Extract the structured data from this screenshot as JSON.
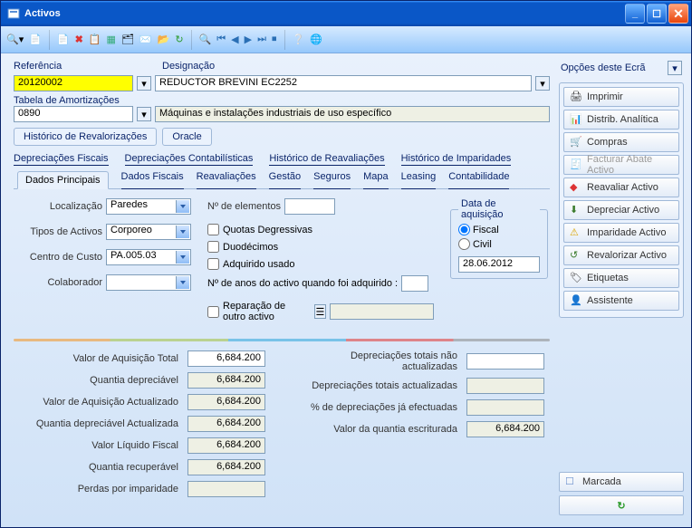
{
  "window": {
    "title": "Activos"
  },
  "header": {
    "ref_label": "Referência",
    "ref_value": "20120002",
    "desig_label": "Designação",
    "desig_value": "REDUCTOR BREVINI EC2252",
    "tab_amort_label": "Tabela de Amortizações",
    "tab_amort_code": "0890",
    "tab_amort_desc": "Máquinas e instalações industriais de uso específico"
  },
  "btnrow": {
    "hist_reval": "Histórico de Revalorizações",
    "oracle": "Oracle"
  },
  "linktabs": [
    "Depreciações Fiscais",
    "Depreciações Contabilísticas",
    "Histórico de Reavaliações",
    "Histórico de Imparidades"
  ],
  "subtabs": [
    "Dados Principais",
    "Dados Fiscais",
    "Reavaliações",
    "Gestão",
    "Seguros",
    "Mapa",
    "Leasing",
    "Contabilidade"
  ],
  "form": {
    "localizacao": {
      "label": "Localização",
      "value": "Paredes"
    },
    "tipos": {
      "label": "Tipos de Activos",
      "value": "Corporeo"
    },
    "centro": {
      "label": "Centro de Custo",
      "value": "PA.005.03"
    },
    "colab": {
      "label": "Colaborador",
      "value": ""
    },
    "n_elem": {
      "label": "Nº de elementos",
      "value": ""
    },
    "quotas": "Quotas Degressivas",
    "duodec": "Duodécimos",
    "adq_usado": "Adquirido usado",
    "anos_label": "Nº de anos do activo quando foi adquirido :",
    "anos_value": "",
    "reparacao": "Reparação de outro activo",
    "data_acq": {
      "legend": "Data de aquisição",
      "fiscal": "Fiscal",
      "civil": "Civil",
      "value": "28.06.2012"
    }
  },
  "vals_left": {
    "v1": {
      "l": "Valor de Aquisição Total",
      "v": "6,684.200"
    },
    "v2": {
      "l": "Quantia depreciável",
      "v": "6,684.200"
    },
    "v3": {
      "l": "Valor de Aquisição Actualizado",
      "v": "6,684.200"
    },
    "v4": {
      "l": "Quantia depreciável Actualizada",
      "v": "6,684.200"
    },
    "v5": {
      "l": "Valor Líquido Fiscal",
      "v": "6,684.200"
    },
    "v6": {
      "l": "Quantia recuperável",
      "v": "6,684.200"
    },
    "v7": {
      "l": "Perdas por imparidade",
      "v": ""
    }
  },
  "vals_right": {
    "v1": {
      "l": "Depreciações totais não actualizadas",
      "v": ""
    },
    "v2": {
      "l": "Depreciações totais actualizadas",
      "v": ""
    },
    "v3": {
      "l": "% de depreciações já efectuadas",
      "v": ""
    },
    "v4": {
      "l": "Valor da quantia escriturada",
      "v": "6,684.200"
    }
  },
  "side": {
    "head": "Opções deste Ecrã",
    "imprimir": "Imprimir",
    "distrib": "Distrib. Analítica",
    "compras": "Compras",
    "facturar": "Facturar Abate Activo",
    "reavaliar": "Reavaliar Activo",
    "depreciar": "Depreciar Activo",
    "imparidade": "Imparidade Activo",
    "revalorizar": "Revalorizar Activo",
    "etiquetas": "Etiquetas",
    "assistente": "Assistente",
    "marcada": "Marcada"
  }
}
